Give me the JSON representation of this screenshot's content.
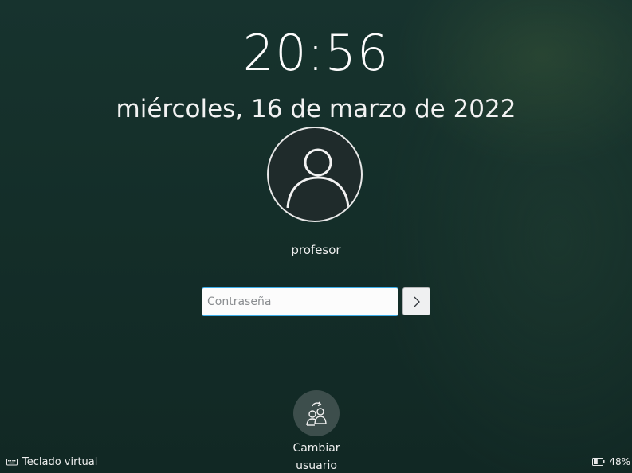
{
  "clock": {
    "time": "20:56",
    "date": "miércoles, 16 de marzo de 2022"
  },
  "user": {
    "avatar_icon": "user-silhouette-icon",
    "name": "profesor"
  },
  "login": {
    "password_placeholder": "Contraseña",
    "password_value": "",
    "submit_icon": "chevron-right-icon"
  },
  "switch_user": {
    "icon": "switch-user-icon",
    "label": "Cambiar usuario"
  },
  "footer": {
    "virtual_keyboard_icon": "keyboard-icon",
    "virtual_keyboard_label": "Teclado virtual",
    "battery_icon": "battery-icon",
    "battery_percent": "48%",
    "battery_level": 0.48
  },
  "colors": {
    "background": "#15302b",
    "accent": "#3daee9",
    "switch_circle": "#3d4e4c"
  }
}
